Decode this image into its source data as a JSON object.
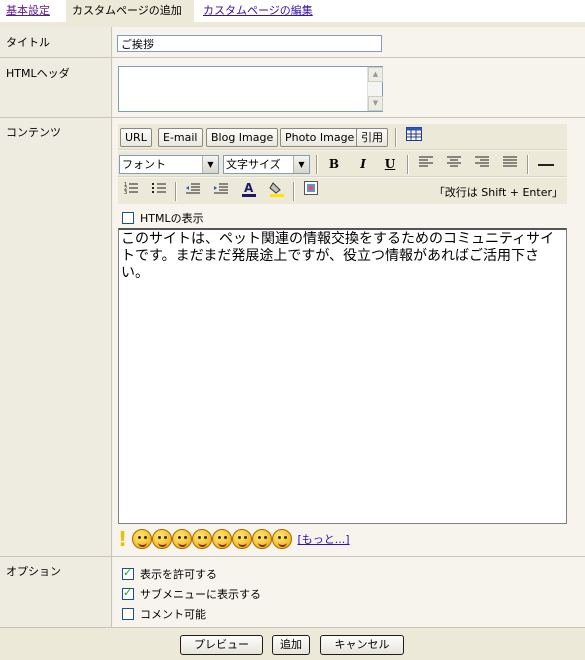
{
  "tabs": [
    {
      "label": "基本設定"
    },
    {
      "label": "カスタムページの追加"
    },
    {
      "label": "カスタムページの編集"
    }
  ],
  "form": {
    "title_label": "タイトル",
    "title_value": "ご挨拶",
    "html_header_label": "HTMLヘッダ",
    "contents_label": "コンテンツ",
    "options_label": "オプション"
  },
  "editor": {
    "buttons": {
      "url": "URL",
      "email": "E-mail",
      "blog_image": "Blog Image",
      "photo_image": "Photo Image",
      "quote": "引用"
    },
    "font_select": "フォント",
    "size_select": "文字サイズ",
    "format": {
      "bold": "B",
      "italic": "I",
      "underline": "U"
    },
    "hint": "「改行は Shift + Enter」",
    "show_html_label": "HTMLの表示",
    "show_html_checked": false,
    "content": "このサイトは、ペット関連の情報交換をするためのコミュニティサイトです。まだまだ発展途上ですが、役立つ情報があればご活用下さい。"
  },
  "emoticons": {
    "more_label": "[もっと...]"
  },
  "options": [
    {
      "label": "表示を許可する",
      "checked": true
    },
    {
      "label": "サブメニューに表示する",
      "checked": true
    },
    {
      "label": "コメント可能",
      "checked": false
    }
  ],
  "footer": {
    "preview": "プレビュー",
    "add": "追加",
    "cancel": "キャンセル"
  }
}
